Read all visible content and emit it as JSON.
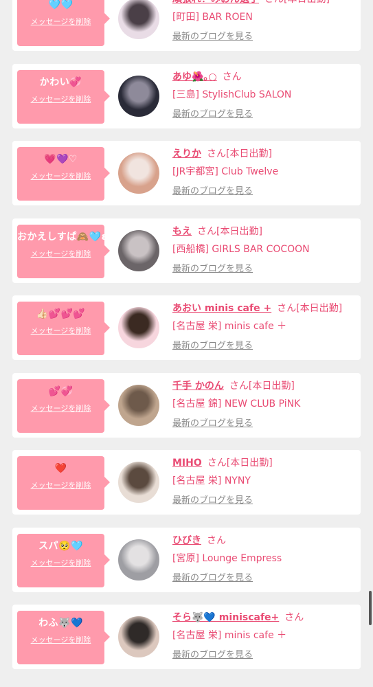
{
  "cards": [
    {
      "message": "🩵🩵",
      "delete_label": "メッセージを削除",
      "name": "頑張れ！みおん選手",
      "san": "さん",
      "status": "[本日出勤]",
      "shop": "[町田] BAR ROEN",
      "blog_label": "最新のブログを見る",
      "avatar_colors": [
        "#e9dce6",
        "#4a3f47"
      ]
    },
    {
      "message": "かわい💞",
      "delete_label": "メッセージを削除",
      "name": "あゆ🌺｡○",
      "san": "さん",
      "status": "",
      "shop": "[三島] StylishClub SALON",
      "blog_label": "最新のブログを見る",
      "avatar_colors": [
        "#2a2b38",
        "#8e8a9a"
      ]
    },
    {
      "message": "💗💜♡",
      "delete_label": "メッセージを削除",
      "name": "えりか",
      "san": "さん",
      "status": "[本日出勤]",
      "shop": "[JR宇都宮] Club Twelve",
      "blog_label": "最新のブログを見る",
      "avatar_colors": [
        "#d8a28c",
        "#f1e4df"
      ]
    },
    {
      "message": "おかえしすぱ🙈🩵ʚ",
      "delete_label": "メッセージを削除",
      "name": "もえ",
      "san": "さん",
      "status": "[本日出勤]",
      "shop": "[西船橋] GIRLS BAR COCOON",
      "blog_label": "最新のブログを見る",
      "avatar_colors": [
        "#6b6568",
        "#c9c2c4"
      ]
    },
    {
      "message": "👍🏻💕💕💕",
      "delete_label": "メッセージを削除",
      "name": "あおい minis cafe +",
      "san": "さん",
      "status": "[本日出勤]",
      "shop": "[名古屋 栄] minis cafe ＋",
      "blog_label": "最新のブログを見る",
      "avatar_colors": [
        "#f7d6de",
        "#3b2a22"
      ]
    },
    {
      "message": "💕💞",
      "delete_label": "メッセージを削除",
      "name": "千手 かのん",
      "san": "さん",
      "status": "[本日出勤]",
      "shop": "[名古屋 錦] NEW CLUB PiNK",
      "blog_label": "最新のブログを見る",
      "avatar_colors": [
        "#bfa58e",
        "#6e5a4b"
      ]
    },
    {
      "message": "❤️",
      "delete_label": "メッセージを削除",
      "name": "MIHO",
      "san": "さん",
      "status": "[本日出勤]",
      "shop": "[名古屋 栄] NYNY",
      "blog_label": "最新のブログを見る",
      "avatar_colors": [
        "#e8ddd5",
        "#5b4a3f"
      ]
    },
    {
      "message": "スパ🥺🩵",
      "delete_label": "メッセージを削除",
      "name": "ひびき",
      "san": "さん",
      "status": "",
      "shop": "[宮原] Lounge Empress",
      "blog_label": "最新のブログを見る",
      "avatar_colors": [
        "#9e9ea3",
        "#e3e1e2"
      ]
    },
    {
      "message": "わふ🐺💙",
      "delete_label": "メッセージを削除",
      "name": "そら🐺💙 miniscafe+",
      "san": "さん",
      "status": "",
      "shop": "[名古屋 栄] minis cafe ＋",
      "blog_label": "最新のブログを見る",
      "avatar_colors": [
        "#dcc8be",
        "#2f2a28"
      ]
    }
  ]
}
